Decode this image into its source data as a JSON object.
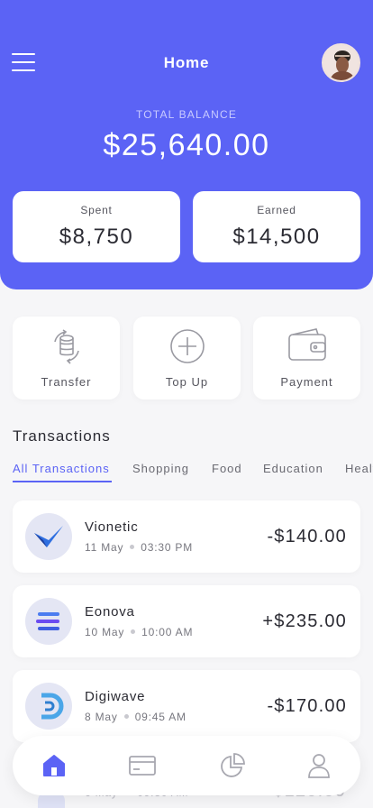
{
  "header": {
    "title": "Home",
    "menu_icon": "hamburger-menu-icon",
    "avatar_icon": "user-avatar",
    "accent_color": "#5b63f5"
  },
  "balance": {
    "label": "TOTAL BALANCE",
    "value": "$25,640.00"
  },
  "stats": {
    "spent": {
      "label": "Spent",
      "value": "$8,750"
    },
    "earned": {
      "label": "Earned",
      "value": "$14,500"
    }
  },
  "actions": [
    {
      "label": "Transfer",
      "icon": "transfer-coins-icon"
    },
    {
      "label": "Top Up",
      "icon": "plus-circle-icon"
    },
    {
      "label": "Payment",
      "icon": "wallet-icon"
    }
  ],
  "transactions": {
    "title": "Transactions",
    "tabs": [
      "All Transactions",
      "Shopping",
      "Food",
      "Education",
      "Healt"
    ],
    "active_tab": "All Transactions",
    "items": [
      {
        "name": "Vionetic",
        "date": "11 May",
        "time": "03:30 PM",
        "amount": "-$140.00",
        "logo": "vionetic-logo"
      },
      {
        "name": "Eonova",
        "date": "10 May",
        "time": "10:00 AM",
        "amount": "+$235.00",
        "logo": "eonova-logo"
      },
      {
        "name": "Digiwave",
        "date": "8 May",
        "time": "09:45 AM",
        "amount": "-$170.00",
        "logo": "digiwave-logo"
      },
      {
        "name": "",
        "date": "6 May",
        "time": "09:30 AM",
        "amount": "-$120.00",
        "logo": "partial-logo"
      }
    ]
  },
  "bottom_nav": [
    {
      "name": "home",
      "icon": "home-icon",
      "active": true
    },
    {
      "name": "cards",
      "icon": "card-icon",
      "active": false
    },
    {
      "name": "statistics",
      "icon": "pie-chart-icon",
      "active": false
    },
    {
      "name": "profile",
      "icon": "profile-icon",
      "active": false
    }
  ]
}
